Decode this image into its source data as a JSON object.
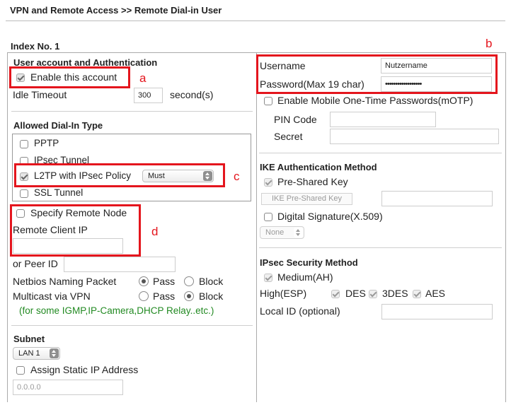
{
  "breadcrumb": "VPN and Remote Access >> Remote Dial-in User",
  "index_label": "Index No. 1",
  "left": {
    "account_section_title": "User account and Authentication",
    "enable_account_label": "Enable this account",
    "idle_timeout_label": "Idle Timeout",
    "idle_timeout_value": "300",
    "idle_timeout_unit": "second(s)",
    "dialin_section_title": "Allowed Dial-In Type",
    "dialin_types": [
      "PPTP",
      "IPsec Tunnel",
      "L2TP with IPsec Policy",
      "SSL Tunnel"
    ],
    "l2tp_policy_value": "Must",
    "specify_remote_node_label": "Specify Remote Node",
    "remote_client_ip_label": "Remote Client IP",
    "peer_id_label": "or Peer ID",
    "netbios_label": "Netbios Naming Packet",
    "multicast_label": "Multicast via VPN",
    "pass_label": "Pass",
    "block_label": "Block",
    "multicast_note": "(for some IGMP,IP-Camera,DHCP Relay..etc.)",
    "subnet_section_title": "Subnet",
    "subnet_value": "LAN 1",
    "assign_static_ip_label": "Assign Static IP Address",
    "static_ip_placeholder": "0.0.0.0"
  },
  "right": {
    "username_label": "Username",
    "username_value": "Nutzername",
    "password_label": "Password(Max 19 char)",
    "password_value": "••••••••••••••••••",
    "motp_label": "Enable Mobile One-Time Passwords(mOTP)",
    "pin_code_label": "PIN Code",
    "secret_label": "Secret",
    "ike_section_title": "IKE Authentication Method",
    "pre_shared_key_label": "Pre-Shared Key",
    "ike_psk_button_label": "IKE Pre-Shared Key",
    "digital_signature_label": "Digital Signature(X.509)",
    "signature_select_value": "None",
    "ipsec_section_title": "IPsec Security Method",
    "medium_ah_label": "Medium(AH)",
    "high_esp_label": "High(ESP)",
    "des_label": "DES",
    "three_des_label": "3DES",
    "aes_label": "AES",
    "local_id_label": "Local ID (optional)"
  },
  "annotations": {
    "a": "a",
    "b": "b",
    "c": "c",
    "d": "d"
  },
  "colors": {
    "annotation_red": "#e4151d",
    "note_green": "#228a22"
  }
}
